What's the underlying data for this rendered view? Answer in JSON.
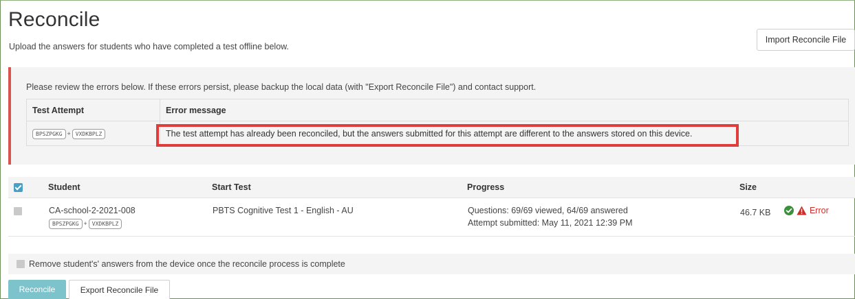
{
  "header": {
    "title": "Reconcile",
    "subtitle": "Upload the answers for students who have completed a test offline below.",
    "import_button": "Import Reconcile File"
  },
  "error_panel": {
    "intro": "Please review the errors below. If these errors persist, please backup the local data (with \"Export Reconcile File\") and contact support.",
    "columns": [
      "Test Attempt",
      "Error message"
    ],
    "rows": [
      {
        "code1": "BPSZPGKG",
        "code2": "VXDKBPLZ",
        "message": "The test attempt has already been reconciled, but the answers submitted for this attempt are different to the answers stored on this device."
      }
    ]
  },
  "students_table": {
    "columns": [
      "Student",
      "Start Test",
      "Progress",
      "Size"
    ],
    "rows": [
      {
        "student": "CA-school-2-2021-008",
        "code1": "BPSZPGKG",
        "code2": "VXDKBPLZ",
        "test": "PBTS Cognitive Test 1 - English - AU",
        "progress_line1": "Questions: 69/69 viewed, 64/69 answered",
        "progress_line2": "Attempt submitted: May 11, 2021 12:39 PM",
        "size": "46.7 KB",
        "status": "Error"
      }
    ]
  },
  "remove_option": "Remove student's' answers from the device once the reconcile process is complete",
  "footer": {
    "reconcile_button": "Reconcile",
    "export_button": "Export Reconcile File"
  },
  "colors": {
    "error_border": "#d9534f",
    "highlight": "#e03c3c",
    "reconcile_button": "#7cc3cc",
    "checkbox_checked": "#4a9fc5",
    "ok_green": "#3c8f3c",
    "error_text": "#c9302c"
  },
  "icons": {
    "ok": "check-circle-icon",
    "warning": "warning-triangle-icon"
  }
}
